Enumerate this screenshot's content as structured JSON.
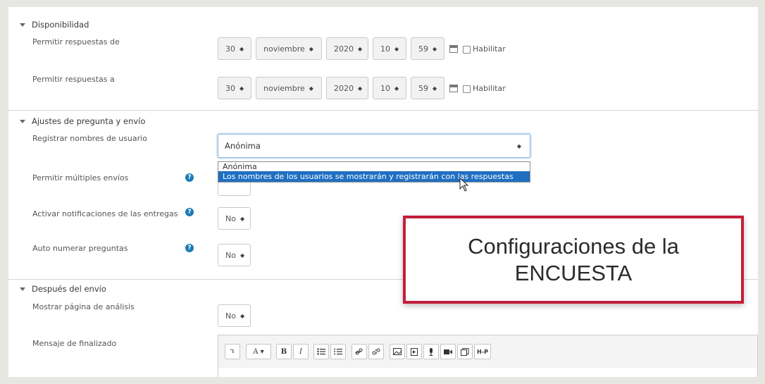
{
  "sections": {
    "availability": {
      "title": "Disponibilidad",
      "rows": [
        {
          "label": "Permitir respuestas de",
          "day": "30",
          "month": "noviembre",
          "year": "2020",
          "hour": "10",
          "minute": "59",
          "enable_label": "Habilitar"
        },
        {
          "label": "Permitir respuestas a",
          "day": "30",
          "month": "noviembre",
          "year": "2020",
          "hour": "10",
          "minute": "59",
          "enable_label": "Habilitar"
        }
      ]
    },
    "question_settings": {
      "title": "Ajustes de pregunta y envío",
      "record_names": {
        "label": "Registrar nombres de usuario",
        "value": "Anónima",
        "options": [
          "Anónima",
          "Los nombres de los usuarios se mostrarán y registrarán con las respuestas"
        ],
        "highlighted_option": "Los nombres de los usuarios se mostrarán y registrarán con las respuestas"
      },
      "multiple_submissions": {
        "label": "Permitir múltiples envíos"
      },
      "notifications": {
        "label": "Activar notificaciones de las entregas",
        "value": "No"
      },
      "autonumber": {
        "label": "Auto numerar preguntas",
        "value": "No"
      }
    },
    "after_submit": {
      "title": "Después del envío",
      "analysis_page": {
        "label": "Mostrar página de análisis",
        "value": "No"
      },
      "finish_message": {
        "label": "Mensaje de finalizado"
      }
    }
  },
  "editor_toolbar": {
    "buttons": [
      "expand",
      "font-color",
      "bold",
      "italic",
      "unordered-list",
      "ordered-list",
      "link",
      "unlink",
      "image",
      "media",
      "record-audio",
      "record-video",
      "manage-files",
      "h5p"
    ],
    "labels": {
      "expand": "↴",
      "font_color": "A ▾",
      "bold": "B",
      "italic": "I",
      "h5p": "H-P"
    }
  },
  "overlay": {
    "line1": "Configuraciones de la",
    "line2": "ENCUESTA",
    "border_color": "#c41e3a"
  },
  "colors": {
    "help_icon": "#1f79b8",
    "dropdown_highlight": "#1f6fc2"
  },
  "icons": {
    "calendar": "calendar-icon",
    "help": "question-circle-icon",
    "caret": "caret-down-icon",
    "cursor": "mouse-pointer-icon"
  }
}
